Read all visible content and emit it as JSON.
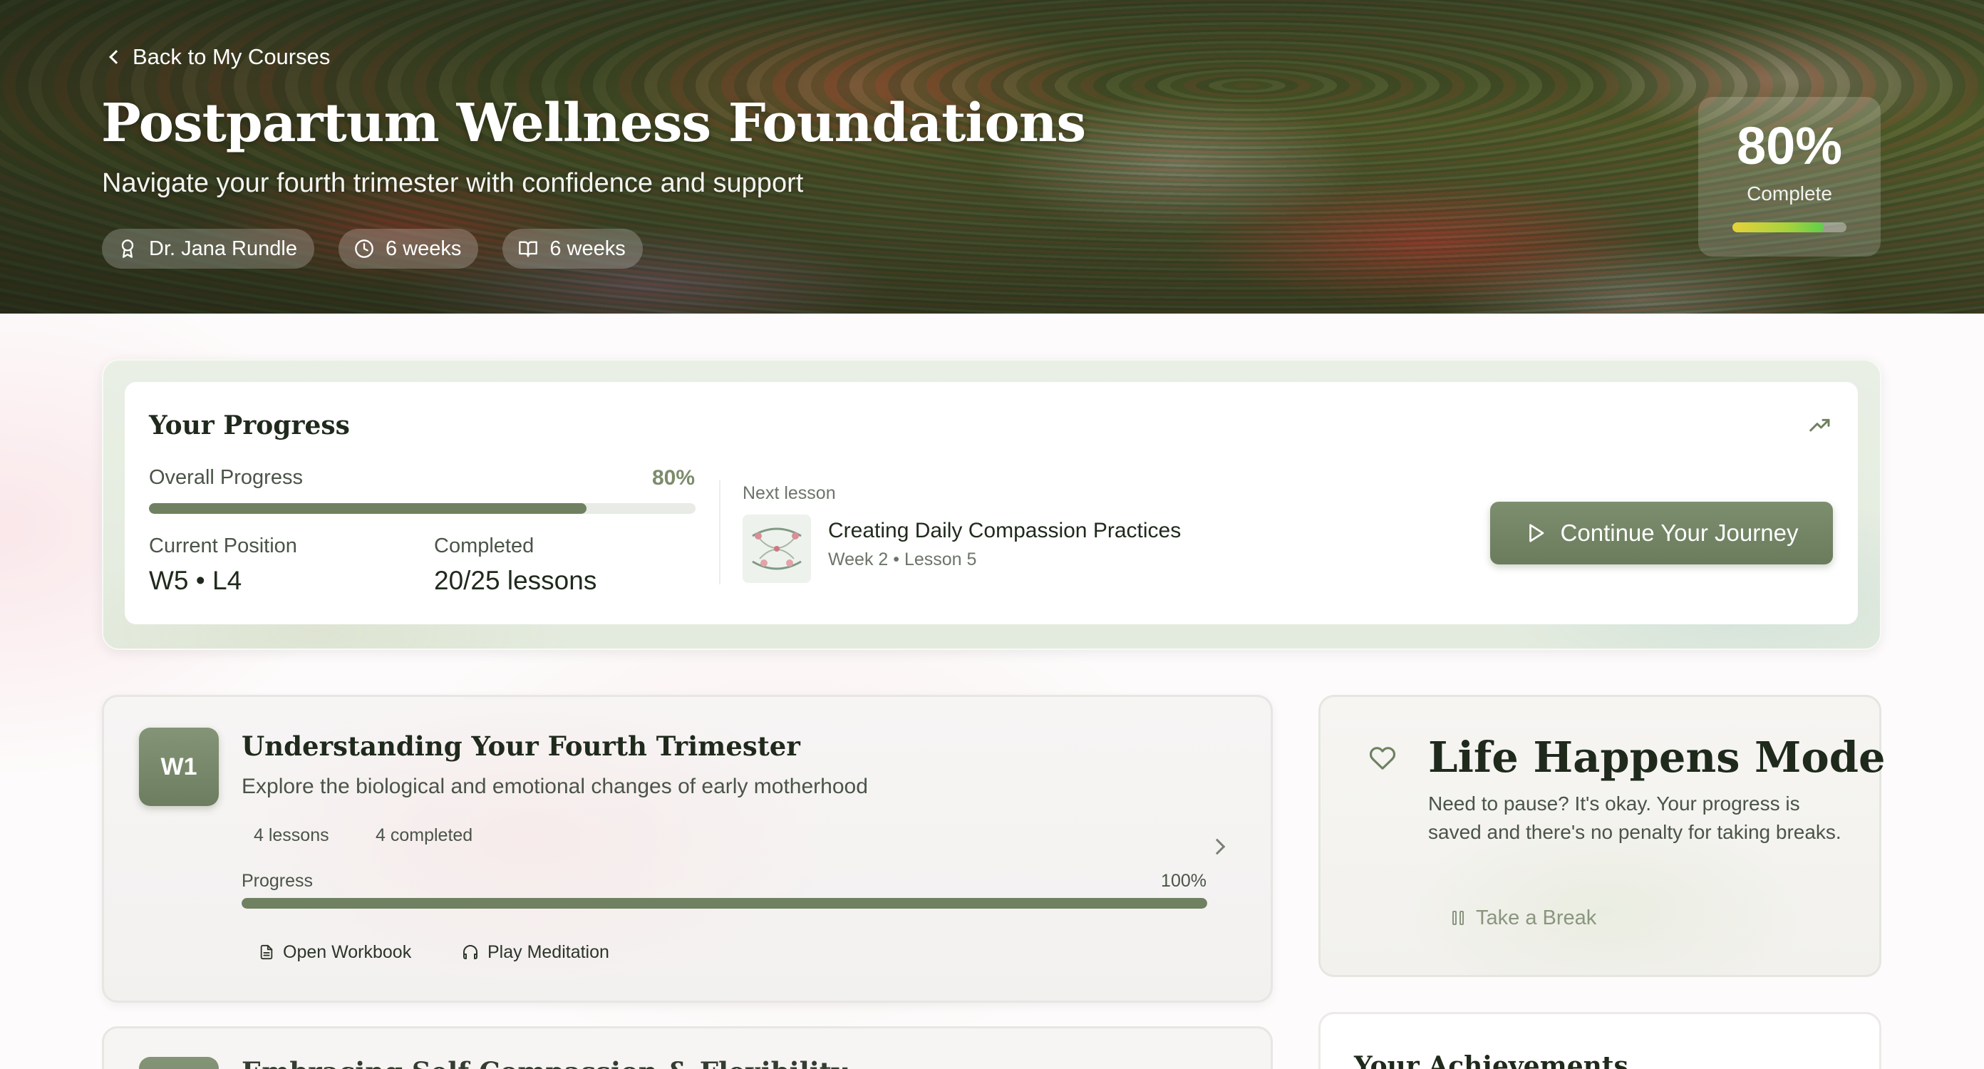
{
  "hero": {
    "back_label": "Back to My Courses",
    "title": "Postpartum Wellness Foundations",
    "subtitle": "Navigate your fourth trimester with confidence and support",
    "chips": [
      {
        "icon": "award-icon",
        "label": "Dr. Jana Rundle"
      },
      {
        "icon": "clock-icon",
        "label": "6 weeks"
      },
      {
        "icon": "book-open-icon",
        "label": "6 weeks"
      }
    ],
    "complete": {
      "percent_label": "80%",
      "label": "Complete",
      "progress": 0.8
    }
  },
  "progress": {
    "title": "Your Progress",
    "overall_label": "Overall Progress",
    "overall_percent_label": "80%",
    "overall_progress": 0.8,
    "current_position_label": "Current Position",
    "current_position_value": "W5 • L4",
    "completed_label": "Completed",
    "completed_value": "20/25 lessons",
    "next_lesson": {
      "label": "Next lesson",
      "title": "Creating Daily Compassion Practices",
      "subtitle": "Week 2 • Lesson 5"
    },
    "continue_label": "Continue Your Journey"
  },
  "weeks": [
    {
      "badge": "W1",
      "title": "Understanding Your Fourth Trimester",
      "description": "Explore the biological and emotional changes of early motherhood",
      "lessons_label": "4 lessons",
      "completed_label": "4 completed",
      "progress_label": "Progress",
      "progress_percent_label": "100%",
      "progress": 1.0,
      "workbook_label": "Open Workbook",
      "meditation_label": "Play Meditation"
    },
    {
      "title": "Embracing Self-Compassion & Flexibility"
    }
  ],
  "life_happens": {
    "title": "Life Happens Mode",
    "description": "Need to pause? It's okay. Your progress is saved and there's no penalty for taking breaks.",
    "button_label": "Take a Break"
  },
  "achievements": {
    "title": "Your Achievements"
  },
  "colors": {
    "accent": "#6f8160",
    "button": "#768769",
    "text_dark": "#1f2a1c",
    "text_muted": "#4a5448"
  }
}
